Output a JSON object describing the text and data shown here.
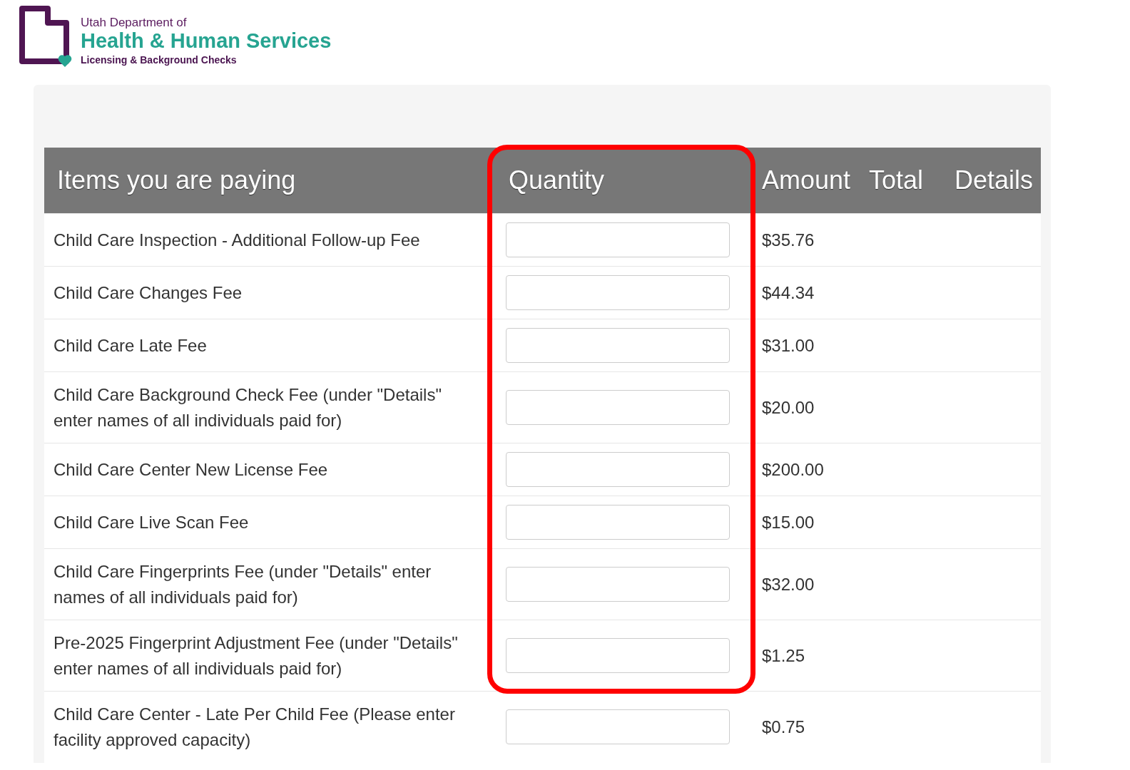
{
  "logo": {
    "line_1": "Utah Department of",
    "line_2": "Health & Human Services",
    "line_3": "Licensing & Background Checks"
  },
  "table": {
    "columns": [
      {
        "label": "Items you are paying",
        "highlighted": false
      },
      {
        "label": "Quantity",
        "highlighted": true
      },
      {
        "label": "Amount",
        "highlighted": false
      },
      {
        "label": "Total",
        "highlighted": false
      },
      {
        "label": "Details",
        "highlighted": false
      }
    ],
    "rows": [
      {
        "item": "Child Care Inspection - Additional Follow-up Fee",
        "amount": "$35.76"
      },
      {
        "item": "Child Care Changes Fee",
        "amount": "$44.34"
      },
      {
        "item": "Child Care Late Fee",
        "amount": "$31.00"
      },
      {
        "item": "Child Care Background Check Fee (under \"Details\" enter names of all individuals paid for)",
        "amount": "$20.00"
      },
      {
        "item": "Child Care Center New License Fee",
        "amount": "$200.00"
      },
      {
        "item": "Child Care Live Scan Fee",
        "amount": "$15.00"
      },
      {
        "item": "Child Care Fingerprints Fee (under \"Details\" enter names of all individuals paid for)",
        "amount": "$32.00"
      },
      {
        "item": "Pre-2025 Fingerprint Adjustment Fee (under \"Details\" enter names of all individuals paid for)",
        "amount": "$1.25"
      },
      {
        "item": "Child Care Center - Late Per Child Fee (Please enter facility approved capacity)",
        "amount": "$0.75"
      }
    ]
  }
}
